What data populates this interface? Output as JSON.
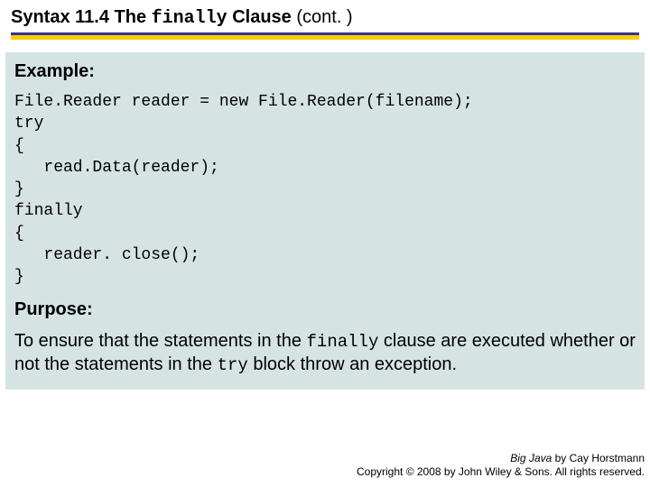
{
  "title": {
    "prefix": "Syntax 11.4 The ",
    "keyword": "finally",
    "suffix": " Clause ",
    "cont": " (cont. )"
  },
  "example": {
    "heading": "Example:",
    "code": "File.Reader reader = new File.Reader(filename);\ntry\n{\n   read.Data(reader);\n}\nfinally\n{\n   reader. close();\n}"
  },
  "purpose": {
    "heading": "Purpose:",
    "seg1": "To ensure that the statements in the ",
    "kw1": "finally",
    "seg2": " clause are executed whether or not the statements in the ",
    "kw2": "try",
    "seg3": " block throw an exception."
  },
  "footer": {
    "book": "Big Java",
    "byline": " by Cay Horstmann",
    "copyright": "Copyright © 2008 by John Wiley & Sons.  All rights reserved."
  }
}
